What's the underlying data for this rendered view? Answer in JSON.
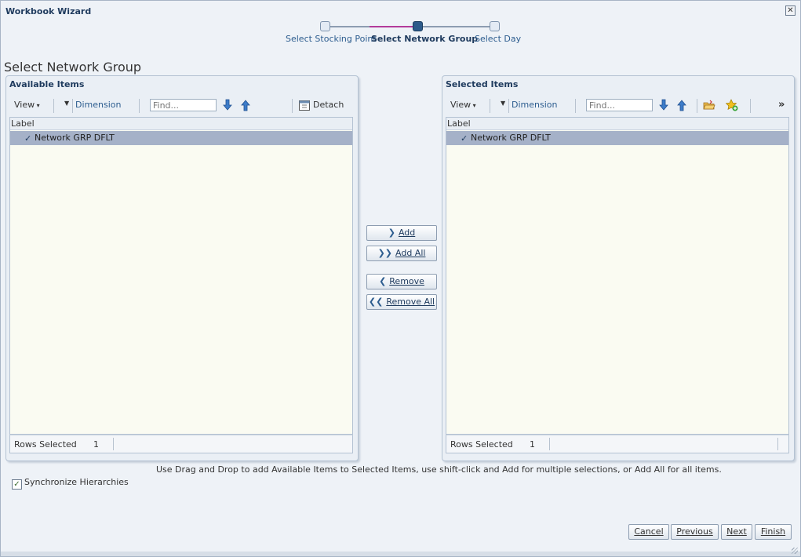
{
  "dialog": {
    "title": "Workbook Wizard",
    "close_glyph": "✕"
  },
  "train": {
    "steps": [
      {
        "label": "Select Stocking Point",
        "state": "visited"
      },
      {
        "label": "Select Network Group",
        "state": "current"
      },
      {
        "label": "Select Day",
        "state": "unvisited"
      }
    ]
  },
  "page_heading": "Select Network Group",
  "available": {
    "header": "Available Items",
    "toolbar": {
      "view_label": "View",
      "dimension_label": "Dimension",
      "find_placeholder": "Find...",
      "detach_label": "Detach",
      "icons": [
        "chevron-down-icon",
        "arrow-down-icon",
        "arrow-up-icon",
        "detach-icon"
      ]
    },
    "grid": {
      "column_header": "Label",
      "rows": [
        {
          "label": "Network GRP DFLT",
          "selected": true
        }
      ]
    },
    "footer": {
      "rows_selected_label": "Rows Selected",
      "rows_selected_value": "1"
    }
  },
  "selected": {
    "header": "Selected Items",
    "toolbar": {
      "view_label": "View",
      "dimension_label": "Dimension",
      "find_placeholder": "Find...",
      "more_glyph": "»",
      "icons": [
        "chevron-down-icon",
        "arrow-down-icon",
        "arrow-up-icon",
        "folder-open-icon",
        "star-add-icon"
      ]
    },
    "grid": {
      "column_header": "Label",
      "rows": [
        {
          "label": "Network GRP DFLT",
          "selected": true
        }
      ]
    },
    "footer": {
      "rows_selected_label": "Rows Selected",
      "rows_selected_value": "1"
    }
  },
  "shuttle": {
    "add": {
      "label": "Add",
      "glyph": "❯"
    },
    "add_all": {
      "label": "Add All",
      "glyph": "❯❯"
    },
    "remove": {
      "label": "Remove",
      "glyph": "❮"
    },
    "remove_all": {
      "label": "Remove All",
      "glyph": "❮❮"
    }
  },
  "instruction": "Use Drag and Drop to add Available Items to Selected Items, use shift-click and Add for multiple selections, or Add All for all items.",
  "sync": {
    "label": "Synchronize Hierarchies",
    "checked": true,
    "check_glyph": "✓"
  },
  "nav": {
    "cancel": "Cancel",
    "previous": "Previous",
    "next": "Next",
    "finish": "Finish"
  },
  "colors": {
    "accent": "#1f3b5e",
    "link": "#2d5d8f",
    "selection": "#a5b1c8",
    "train_current": "#2d5b8a",
    "train_progress": "#b33b9a"
  }
}
